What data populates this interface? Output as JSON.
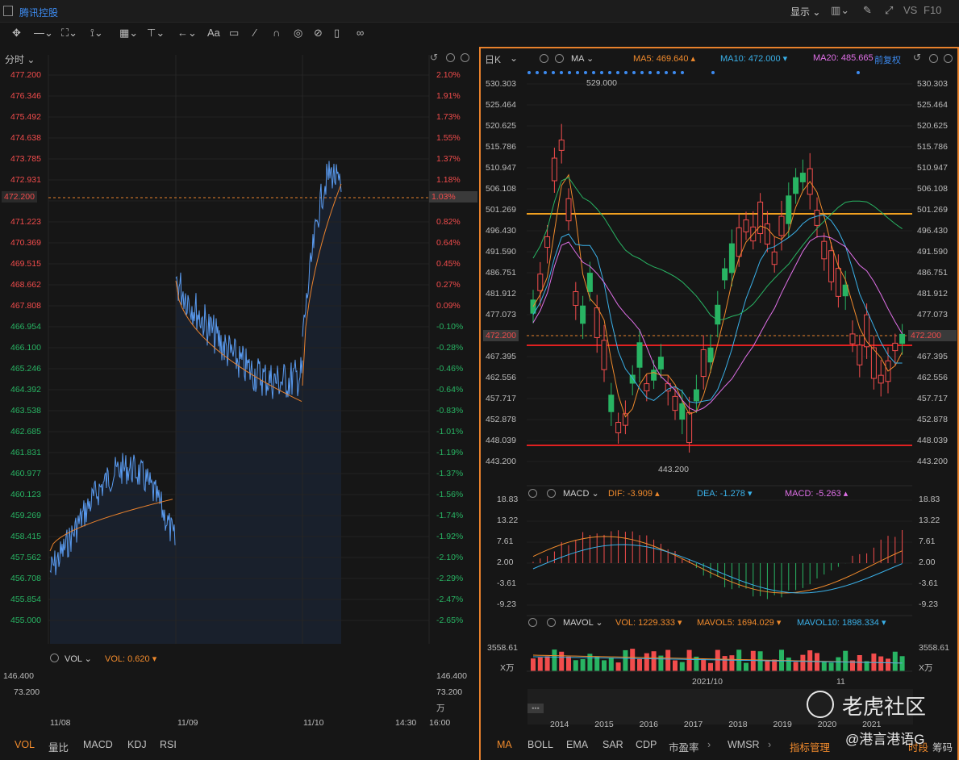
{
  "window": {
    "stock_name": "腾讯控股",
    "display_label": "显示",
    "vs_label": "VS",
    "f10_label": "F10"
  },
  "toolbar": {
    "icons": [
      "move-icon",
      "line-icon",
      "rect-icon",
      "path-icon",
      "ruler-icon",
      "text-tool-icon",
      "arrow-icon",
      "font-icon",
      "comment-icon",
      "pen-icon",
      "magnet-icon",
      "eye-icon",
      "hide-icon",
      "trash-icon",
      "link-icon"
    ],
    "font_label": "Aa"
  },
  "left": {
    "period": "分时",
    "price_ticks": [
      "477.200",
      "476.346",
      "475.492",
      "474.638",
      "473.785",
      "472.931",
      "472.200",
      "471.223",
      "470.369",
      "469.515",
      "468.662",
      "467.808",
      "466.954",
      "466.100",
      "465.246",
      "464.392",
      "463.538",
      "462.685",
      "461.831",
      "460.977",
      "460.123",
      "459.269",
      "458.415",
      "457.562",
      "456.708",
      "455.854",
      "455.000"
    ],
    "pct_ticks": [
      "2.10%",
      "1.91%",
      "1.73%",
      "1.55%",
      "1.37%",
      "1.18%",
      "1.03%",
      "0.82%",
      "0.64%",
      "0.45%",
      "0.27%",
      "0.09%",
      "-0.10%",
      "-0.28%",
      "-0.46%",
      "-0.64%",
      "-0.83%",
      "-1.01%",
      "-1.19%",
      "-1.37%",
      "-1.56%",
      "-1.74%",
      "-1.92%",
      "-2.10%",
      "-2.29%",
      "-2.47%",
      "-2.65%"
    ],
    "vol_indicator": "VOL",
    "vol_value": "VOL: 0.620 ▾",
    "vol_ticks": [
      "146.400",
      "73.200"
    ],
    "vol_unit": "万",
    "dates": [
      "11/08",
      "11/09",
      "11/10",
      "14:30",
      "16:00"
    ],
    "tabs": [
      "VOL",
      "量比",
      "MACD",
      "KDJ",
      "RSI"
    ],
    "active_tab": "VOL"
  },
  "right": {
    "period": "日K",
    "ma_label": "MA",
    "ma5": "MA5: 469.640 ▴",
    "ma10": "MA10: 472.000 ▾",
    "ma20": "MA20: 485.665",
    "adjust": "前复权",
    "price_ticks": [
      "530.303",
      "525.464",
      "520.625",
      "515.786",
      "510.947",
      "506.108",
      "501.269",
      "496.430",
      "491.590",
      "486.751",
      "481.912",
      "477.073",
      "472.200",
      "467.395",
      "462.556",
      "457.717",
      "452.878",
      "448.039",
      "443.200"
    ],
    "high_label": "529.000",
    "low_label": "443.200",
    "current_price": "472.200",
    "macd_name": "MACD",
    "dif": "DIF: -3.909 ▴",
    "dea": "DEA: -1.278 ▾",
    "macd": "MACD: -5.263 ▴",
    "macd_ticks": [
      "18.83",
      "13.22",
      "7.61",
      "2.00",
      "-3.61",
      "-9.23"
    ],
    "mavol_name": "MAVOL",
    "vol": "VOL: 1229.333 ▾",
    "mavol5": "MAVOL5: 1694.029 ▾",
    "mavol10": "MAVOL10: 1898.334 ▾",
    "vol_ticks": [
      "3558.61"
    ],
    "vol_unit": "X万",
    "date_label": "2021/10",
    "date_label2": "11",
    "years": [
      "2014",
      "2015",
      "2016",
      "2017",
      "2018",
      "2019",
      "2020",
      "2021"
    ],
    "tabs": [
      "MA",
      "BOLL",
      "EMA",
      "SAR",
      "CDP",
      "市盈率",
      "WMSR",
      "指标管理",
      "时段",
      "筹码"
    ],
    "active_tab": "MA"
  },
  "watermark": {
    "brand": "老虎社区",
    "author": "@港言港语G"
  },
  "colors": {
    "up": "#f24c4c",
    "down": "#28b463",
    "accent": "#e8812c",
    "price_line": "#5a9bf0"
  }
}
